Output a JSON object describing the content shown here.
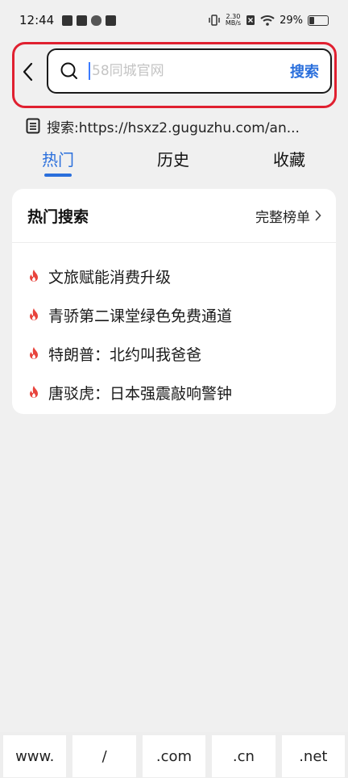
{
  "status_bar": {
    "time": "12:44",
    "net_speed_value": "2.30",
    "net_speed_unit": "MB/s",
    "battery_percent": "29%",
    "battery_level": 0.29
  },
  "search": {
    "placeholder": "58同城官网",
    "value": "",
    "submit_label": "搜索"
  },
  "suggestion": {
    "text": "搜索:https://hsxz2.guguzhu.com/an..."
  },
  "tabs": [
    {
      "label": "热门",
      "active": true
    },
    {
      "label": "历史",
      "active": false
    },
    {
      "label": "收藏",
      "active": false
    }
  ],
  "hot_card": {
    "title": "热门搜索",
    "full_list_label": "完整榜单",
    "items": [
      {
        "text": "文旅赋能消费升级"
      },
      {
        "text": "青骄第二课堂绿色免费通道"
      },
      {
        "text": "特朗普：北约叫我爸爸"
      },
      {
        "text": "唐驳虎：日本强震敲响警钟"
      }
    ]
  },
  "shortcuts": [
    "www.",
    "/",
    ".com",
    ".cn",
    ".net"
  ],
  "colors": {
    "accent": "#2a6fdc",
    "highlight": "#e02030",
    "fire": "#e8433c"
  }
}
